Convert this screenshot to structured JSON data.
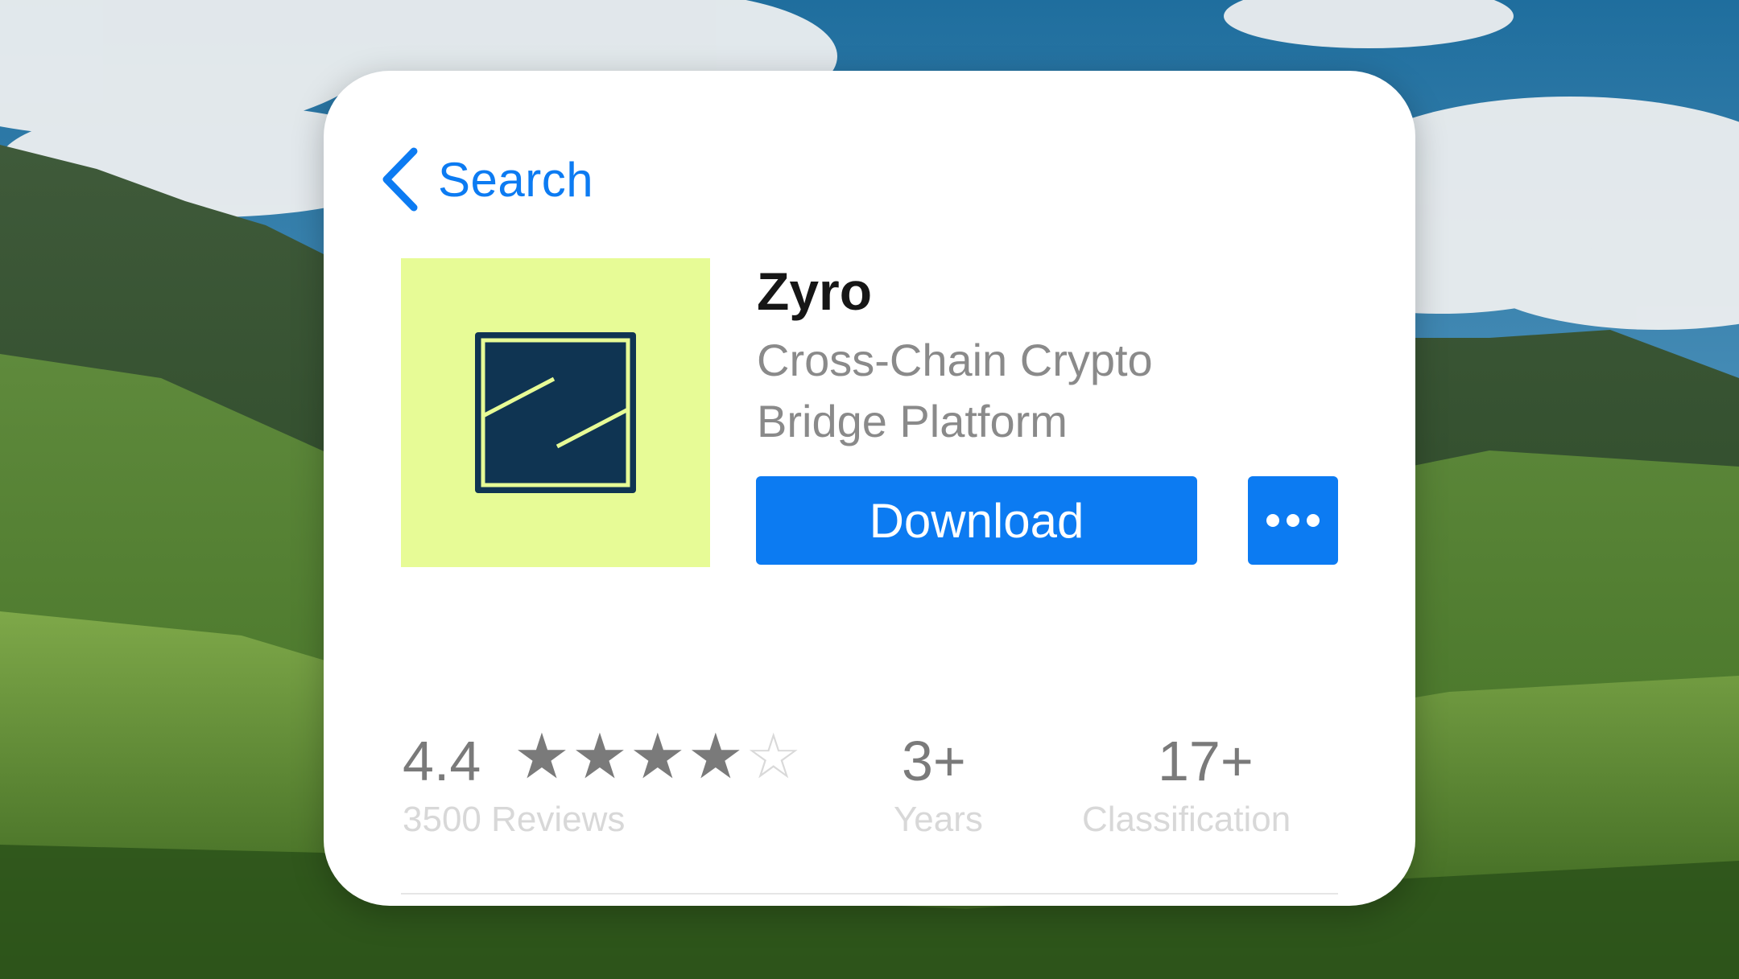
{
  "back": {
    "label": "Search"
  },
  "app": {
    "name": "Zyro",
    "subtitle": "Cross-Chain Crypto Bridge Platform",
    "download_label": "Download",
    "icon": "zyro-logo"
  },
  "stats": {
    "rating": {
      "value": "4.4",
      "stars": 4.4,
      "max_stars": 5,
      "label": "3500 Reviews"
    },
    "age": {
      "value": "3+",
      "label": "Years"
    },
    "classification": {
      "value": "17+",
      "label": "Classification"
    }
  },
  "colors": {
    "accent": "#0c7bf2",
    "icon_background": "#e7fb96",
    "icon_foreground": "#0f3452"
  }
}
